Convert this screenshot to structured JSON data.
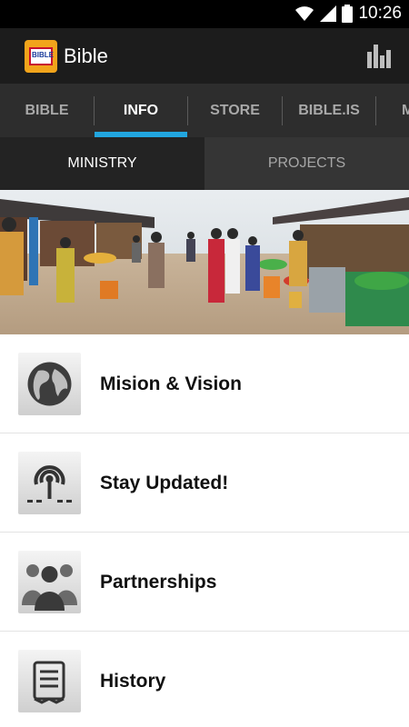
{
  "status_bar": {
    "time": "10:26"
  },
  "app_bar": {
    "logo_text": "BIBLE",
    "title": "Bible",
    "stats_icon": "bar-chart-icon"
  },
  "tabs": [
    {
      "label": "BIBLE",
      "active": false
    },
    {
      "label": "INFO",
      "active": true
    },
    {
      "label": "STORE",
      "active": false
    },
    {
      "label": "BIBLE.IS",
      "active": false
    },
    {
      "label": "M",
      "active": false
    }
  ],
  "subtabs": [
    {
      "label": "MINISTRY",
      "active": true
    },
    {
      "label": "PROJECTS",
      "active": false
    }
  ],
  "banner": {
    "subject": "market-photo"
  },
  "list": [
    {
      "label": "Mision & Vision",
      "icon": "globe-icon"
    },
    {
      "label": "Stay Updated!",
      "icon": "podcast-icon"
    },
    {
      "label": "Partnerships",
      "icon": "people-icon"
    },
    {
      "label": "History",
      "icon": "scroll-icon"
    }
  ],
  "colors": {
    "accent": "#22a6df",
    "app_bar": "#1c1c1c",
    "tabs": "#2d2d2d"
  }
}
